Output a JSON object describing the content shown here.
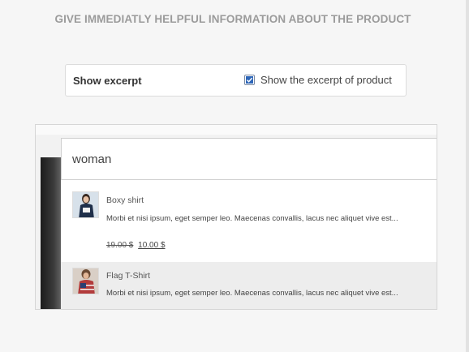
{
  "heading": "GIVE IMMEDIATLY HELPFUL INFORMATION ABOUT THE PRODUCT",
  "excerpt_setting": {
    "label": "Show excerpt",
    "option_label": "Show the excerpt of product",
    "checked": true
  },
  "search": {
    "value": "woman"
  },
  "results": [
    {
      "title": "Boxy shirt",
      "description": "Morbi et nisi ipsum, eget semper leo. Maecenas convallis, lacus nec aliquet vive est...",
      "old_price": "19.00 $",
      "new_price": "10.00 $"
    },
    {
      "title": "Flag T-Shirt",
      "description": "Morbi et nisi ipsum, eget semper leo. Maecenas convallis, lacus nec aliquet vive est..."
    }
  ],
  "colors": {
    "heading": "#9b9b9b",
    "checkbox_accent": "#2e66b8",
    "hover_row": "#ededed"
  }
}
